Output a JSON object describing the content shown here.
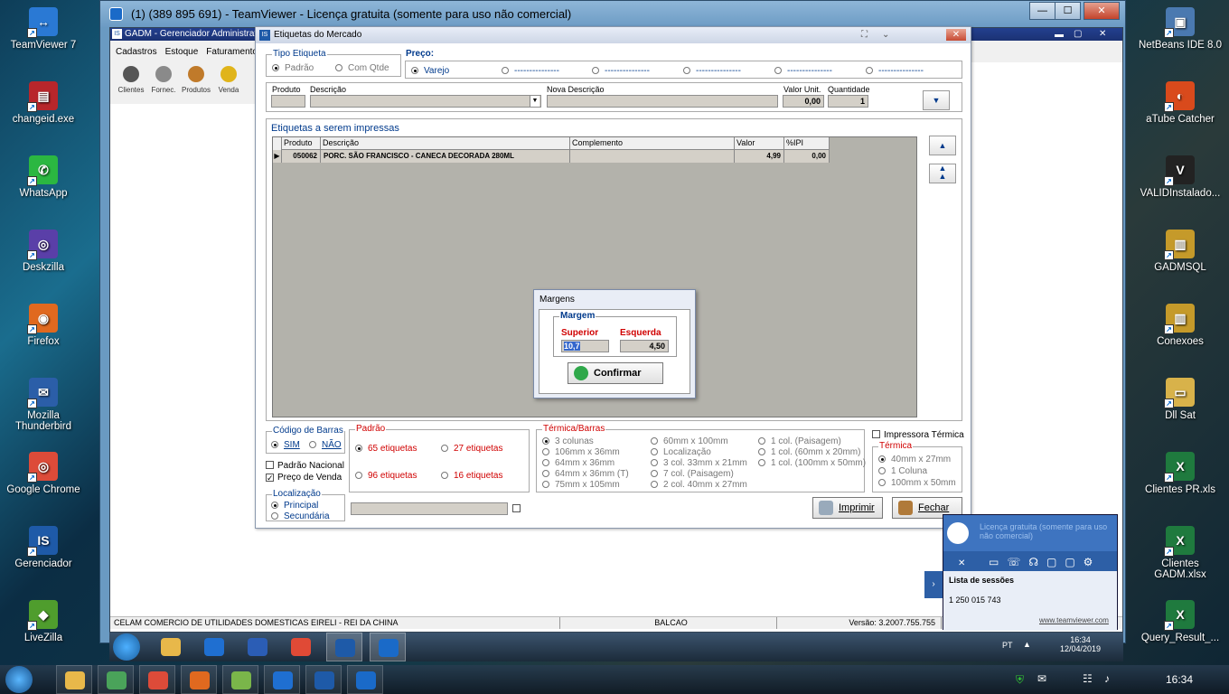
{
  "desktop_left": [
    {
      "label": "TeamViewer 7",
      "color": "#2a79d4",
      "glyph": "↔"
    },
    {
      "label": "changeid.exe",
      "color": "#b8262b",
      "glyph": "▤"
    },
    {
      "label": "WhatsApp",
      "color": "#2bb741",
      "glyph": "✆"
    },
    {
      "label": "Deskzilla",
      "color": "#5a3fa8",
      "glyph": "◎"
    },
    {
      "label": "Firefox",
      "color": "#e0691f",
      "glyph": "◉"
    },
    {
      "label": "Mozilla Thunderbird",
      "color": "#2b5ea8",
      "glyph": "✉"
    },
    {
      "label": "Google Chrome",
      "color": "#dd4b39",
      "glyph": "◎"
    },
    {
      "label": "Gerenciador",
      "color": "#1e5aa8",
      "glyph": "IS"
    },
    {
      "label": "LiveZilla",
      "color": "#4f9d2d",
      "glyph": "◆"
    }
  ],
  "desktop_right": [
    {
      "label": "NetBeans IDE 8.0",
      "color": "#4a79b0",
      "glyph": "▣"
    },
    {
      "label": "aTube Catcher",
      "color": "#d94a1c",
      "glyph": "◐"
    },
    {
      "label": "VALIDInstalado...",
      "color": "#222222",
      "glyph": "V"
    },
    {
      "label": "GADMSQL",
      "color": "#c59a2a",
      "glyph": "▥"
    },
    {
      "label": "Conexoes",
      "color": "#c59a2a",
      "glyph": "▥"
    },
    {
      "label": "Dll Sat",
      "color": "#d8b24a",
      "glyph": "▭"
    },
    {
      "label": "Clientes PR.xls",
      "color": "#1f7a3e",
      "glyph": "X"
    },
    {
      "label": "Clientes GADM.xlsx",
      "color": "#1f7a3e",
      "glyph": "X"
    },
    {
      "label": "Query_Result_...",
      "color": "#1f7a3e",
      "glyph": "X"
    }
  ],
  "teamviewer": {
    "title": "(1) (389 895 691) - TeamViewer - Licença gratuita (somente para uso não comercial)",
    "min": "—",
    "max": "☐",
    "close": "✕"
  },
  "gadm": {
    "title": "GADM - Gerenciador Administrati...",
    "menu": [
      "Cadastros",
      "Estoque",
      "Faturamento"
    ],
    "tools": [
      {
        "label": "Clientes",
        "color": "#555555"
      },
      {
        "label": "Fornec.",
        "color": "#8a8a8a"
      },
      {
        "label": "Produtos",
        "color": "#c07a2a"
      },
      {
        "label": "Venda",
        "color": "#e0b41a"
      }
    ],
    "status": [
      "CELAM COMERCIO DE UTILIDADES DOMESTICAS EIRELI - REI DA CHINA",
      "BALCAO",
      "Versão: 3.2007.755.755"
    ]
  },
  "etq": {
    "title": "Etiquetas do Mercado",
    "tipo": {
      "legend": "Tipo Etiqueta",
      "opts": [
        "Padrão",
        "Com Qtde"
      ]
    },
    "preco": {
      "legend": "Preço:",
      "opts": [
        "Varejo",
        "---------------",
        "---------------",
        "---------------",
        "---------------",
        "---------------"
      ]
    },
    "fields": {
      "produto": "Produto",
      "descricao": "Descrição",
      "nova": "Nova Descrição",
      "valor": "Valor Unit.",
      "qtd": "Quantidade",
      "valor_val": "0,00",
      "qtd_val": "1"
    },
    "grid": {
      "title": "Etiquetas a serem impressas",
      "headers": [
        "Produto",
        "Descrição",
        "Complemento",
        "Valor Unitário",
        "%IPI"
      ],
      "rows": [
        [
          "050062",
          "PORC. SÃO FRANCISCO - CANECA DECORADA 280ML",
          "",
          "4,99",
          "0,00"
        ]
      ]
    },
    "codigo": {
      "legend": "Código de Barras",
      "sim": "SIM",
      "nao": "NÃO"
    },
    "padrao_nacional": "Padrão Nacional",
    "preco_venda": "Preço de Venda",
    "localizacao": {
      "legend": "Localização",
      "opts": [
        "Principal",
        "Secundária"
      ]
    },
    "padrao": {
      "legend": "Padrão",
      "opts": [
        "65 etiquetas",
        "27 etiquetas",
        "96 etiquetas",
        "16 etiquetas"
      ]
    },
    "termica_barras": {
      "legend": "Térmica/Barras",
      "col1": [
        "3 colunas",
        "106mm x 36mm",
        "64mm x 36mm",
        "64mm x 36mm (T)",
        "75mm x 105mm"
      ],
      "col2": [
        "60mm x 100mm",
        "Localização",
        "3 col. 33mm x 21mm",
        "7 col. (Paisagem)",
        "2 col. 40mm x 27mm"
      ],
      "col3": [
        "1 col. (Paisagem)",
        "1 col. (60mm x 20mm)",
        "1 col. (100mm x 50mm)"
      ]
    },
    "impressora": "Impressora Térmica",
    "termica": {
      "legend": "Térmica",
      "opts": [
        "40mm x 27mm",
        "1 Coluna",
        "100mm x 50mm"
      ]
    },
    "imprimir": "Imprimir",
    "fechar": "Fechar"
  },
  "margens": {
    "title": "Margens",
    "legend": "Margem",
    "superior": "Superior",
    "esquerda": "Esquerda",
    "superior_val": "10,7",
    "esquerda_val": "4,50",
    "confirmar": "Confirmar"
  },
  "tv_panel": {
    "license": "Licença gratuita (somente para uso não comercial)",
    "sessions": "Lista de sessões",
    "session_id": "1 250 015 743",
    "link": "www.teamviewer.com"
  },
  "remote_tray": {
    "lang": "PT",
    "time": "16:34",
    "date": "12/04/2019"
  },
  "local_tray": {
    "time": "16:34"
  }
}
